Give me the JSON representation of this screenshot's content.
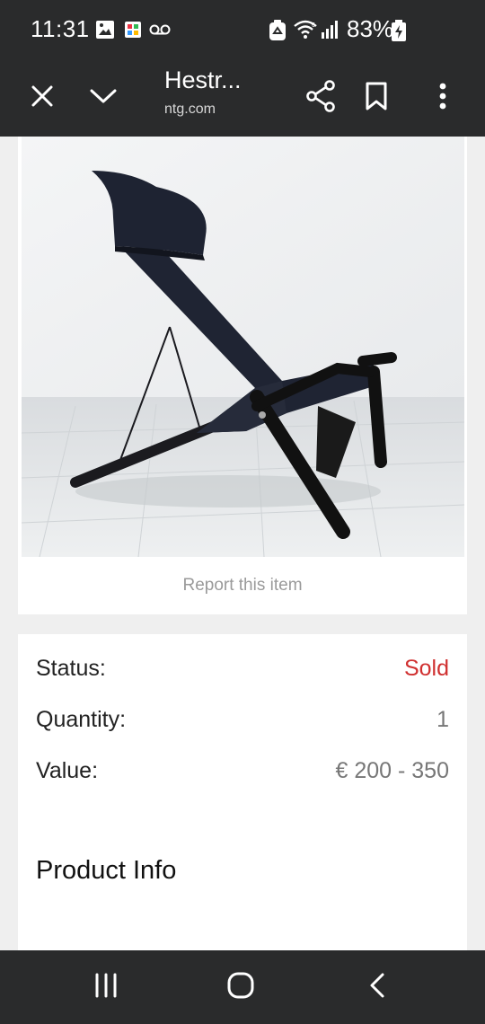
{
  "status_bar": {
    "time": "11:31",
    "battery": "83%",
    "icons": [
      "image-icon",
      "app-grid-icon",
      "voicemail-icon",
      "recycle-icon",
      "wifi-icon",
      "signal-icon",
      "battery-charging-icon"
    ]
  },
  "toolbar": {
    "title": "Hestr...",
    "url": "ntg.com",
    "icons": [
      "close-icon",
      "chevron-down-icon",
      "share-icon",
      "bookmark-icon",
      "more-vert-icon"
    ]
  },
  "product": {
    "report_label": "Report this item",
    "details": {
      "status_label": "Status:",
      "status_value": "Sold",
      "quantity_label": "Quantity:",
      "quantity_value": "1",
      "value_label": "Value:",
      "value_value": "€ 200 - 350"
    },
    "section_title": "Product Info"
  },
  "nav_bar": {
    "icons": [
      "recent-apps-icon",
      "home-icon",
      "back-icon"
    ]
  },
  "colors": {
    "bar_bg": "#2a2b2c",
    "page_bg": "#efefef",
    "sold": "#d03030"
  }
}
